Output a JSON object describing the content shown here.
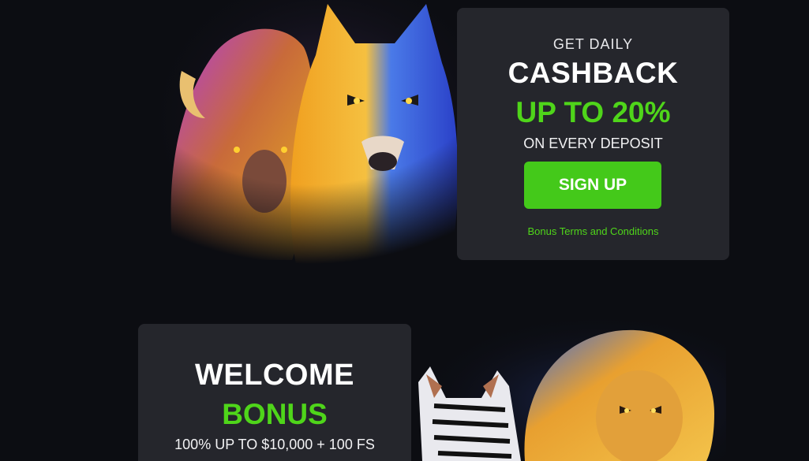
{
  "cashback": {
    "eyebrow": "GET DAILY",
    "headline": "CASHBACK",
    "accent": "UP TO 20%",
    "subtext": "ON EVERY DEPOSIT",
    "button_label": "SIGN UP",
    "terms_link": "Bonus Terms and Conditions",
    "art_icons": [
      "buffalo-icon",
      "wolf-icon"
    ]
  },
  "welcome": {
    "headline": "WELCOME",
    "accent": "BONUS",
    "subtext": "100% UP TO $10,000 + 100 FS",
    "art_icons": [
      "zebra-icon",
      "lion-icon"
    ]
  },
  "colors": {
    "background": "#0c0d12",
    "card": "#25262c",
    "accent_green": "#4fd51a",
    "button_green": "#44c91a"
  }
}
